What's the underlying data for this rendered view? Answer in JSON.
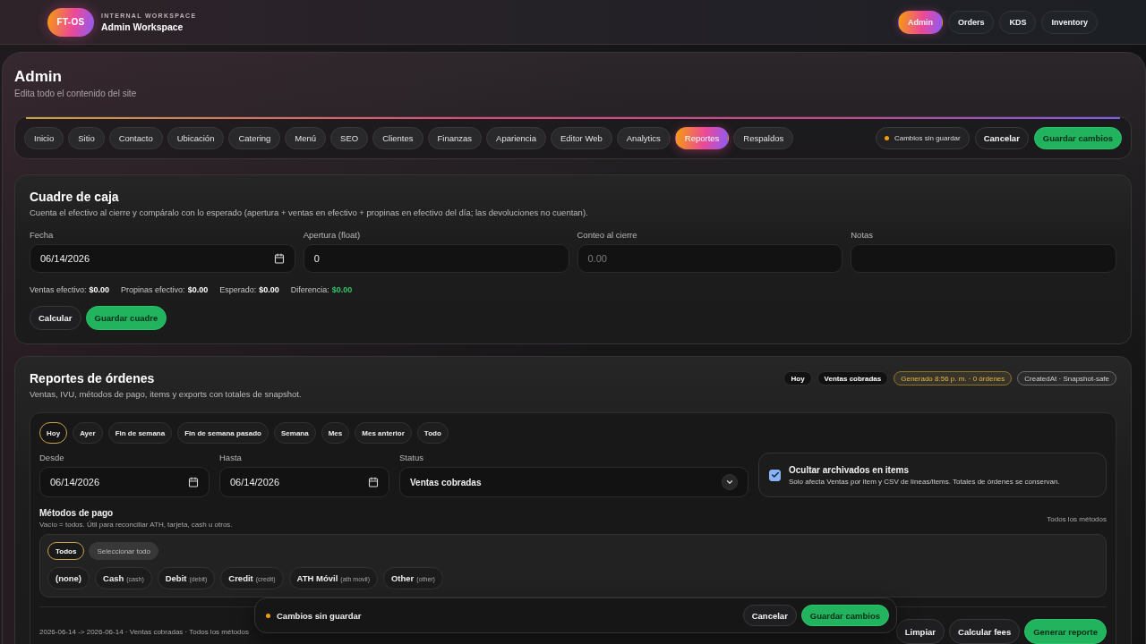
{
  "header": {
    "logo": "FT-OS",
    "eyebrow": "INTERNAL WORKSPACE",
    "title": "Admin Workspace",
    "nav": [
      {
        "label": "Admin",
        "selected": true
      },
      {
        "label": "Orders",
        "selected": false
      },
      {
        "label": "KDS",
        "selected": false
      },
      {
        "label": "Inventory",
        "selected": false
      }
    ]
  },
  "page": {
    "title": "Admin",
    "subtitle": "Edita todo el contenido del site"
  },
  "tabs": [
    {
      "label": "Inicio",
      "selected": false
    },
    {
      "label": "Sitio",
      "selected": false
    },
    {
      "label": "Contacto",
      "selected": false
    },
    {
      "label": "Ubicación",
      "selected": false
    },
    {
      "label": "Catering",
      "selected": false
    },
    {
      "label": "Menú",
      "selected": false
    },
    {
      "label": "SEO",
      "selected": false
    },
    {
      "label": "Clientes",
      "selected": false
    },
    {
      "label": "Finanzas",
      "selected": false
    },
    {
      "label": "Apariencia",
      "selected": false
    },
    {
      "label": "Editor Web",
      "selected": false
    },
    {
      "label": "Analytics",
      "selected": false
    },
    {
      "label": "Reportes",
      "selected": true
    },
    {
      "label": "Respaldos",
      "selected": false
    }
  ],
  "toolbar": {
    "status": "Cambios sin guardar",
    "buttons": [
      {
        "label": "Cancelar",
        "kind": "secondary"
      },
      {
        "label": "Guardar cambios",
        "kind": "primary"
      }
    ]
  },
  "cash_count": {
    "title": "Cuadre de caja",
    "description": "Cuenta el efectivo al cierre y compáralo con lo esperado (apertura + ventas en efectivo + propinas en efectivo del día; las devoluciones no cuentan).",
    "fields": [
      {
        "label": "Fecha",
        "kind": "date",
        "value": "06/14/2026"
      },
      {
        "label": "Apertura (float)",
        "kind": "number",
        "value": "0"
      },
      {
        "label": "Conteo al cierre",
        "kind": "number",
        "placeholder": "0.00"
      },
      {
        "label": "Notas",
        "kind": "text"
      }
    ],
    "summary": [
      {
        "label": "Ventas efectivo:",
        "value": "$0.00",
        "color": "#ffffff"
      },
      {
        "label": "Propinas efectivo:",
        "value": "$0.00",
        "color": "#ffffff"
      },
      {
        "label": "Esperado:",
        "value": "$0.00",
        "color": "#ffffff"
      },
      {
        "label": "Diferencia:",
        "value": "$0.00",
        "color": "#34c46a"
      }
    ],
    "buttons": [
      {
        "label": "Calcular",
        "kind": "secondary"
      },
      {
        "label": "Guardar cuadre",
        "kind": "primary"
      }
    ]
  },
  "reports": {
    "title": "Reportes de órdenes",
    "description": "Ventas, IVU, métodos de pago, items y exports con totales de snapshot.",
    "badges": [
      {
        "label": "Hoy",
        "kind": "filter"
      },
      {
        "label": "Ventas cobradas",
        "kind": "filter"
      },
      {
        "label": "Generado 8:56 p. m. · 0 órdenes",
        "kind": "status"
      },
      {
        "label": "CreatedAt · Snapshot-safe",
        "kind": "info"
      }
    ],
    "presets": [
      {
        "label": "Hoy",
        "selected": true
      },
      {
        "label": "Ayer",
        "selected": false
      },
      {
        "label": "Fin de semana",
        "selected": false
      },
      {
        "label": "Fin de semana pasado",
        "selected": false
      },
      {
        "label": "Semana",
        "selected": false
      },
      {
        "label": "Mes",
        "selected": false
      },
      {
        "label": "Mes anterior",
        "selected": false
      },
      {
        "label": "Todo",
        "selected": false
      }
    ],
    "filters": [
      {
        "label": "Desde",
        "kind": "date",
        "value": "06/14/2026"
      },
      {
        "label": "Hasta",
        "kind": "date",
        "value": "06/14/2026"
      },
      {
        "label": "Status",
        "kind": "select",
        "value": "Ventas cobradas"
      }
    ],
    "hide_archived": {
      "label": "Ocultar archivados en items",
      "description": "Solo afecta Ventas por item y CSV de líneas/items. Totales de órdenes se conservan.",
      "checked": true
    },
    "payment_methods": {
      "title": "Métodos de pago",
      "hint": "Vacío = todos. Útil para reconciliar ATH, tarjeta, cash u otros.",
      "summary": "Todos los métodos",
      "modes": [
        {
          "label": "Todos",
          "selected": true
        },
        {
          "label": "Seleccionar todo",
          "selected": false
        }
      ],
      "methods": [
        {
          "name": "(none)",
          "selected": false
        },
        {
          "name": "Cash",
          "code": "(cash)",
          "selected": false
        },
        {
          "name": "Debit",
          "code": "(debit)",
          "selected": false
        },
        {
          "name": "Credit",
          "code": "(credit)",
          "selected": false
        },
        {
          "name": "ATH Móvil",
          "code": "(ath movil)",
          "selected": false
        },
        {
          "name": "Other",
          "code": "(other)",
          "selected": false
        }
      ]
    },
    "footer": {
      "summary": "2026-06-14 -> 2026-06-14 · Ventas cobradas · Todos los métodos",
      "buttons": [
        {
          "label": "Limpiar",
          "kind": "secondary"
        },
        {
          "label": "Calcular fees",
          "kind": "secondary"
        },
        {
          "label": "Generar reporte",
          "kind": "primary"
        }
      ]
    }
  },
  "unsaved_bar": {
    "status": "Cambios sin guardar",
    "buttons": [
      {
        "label": "Cancelar",
        "kind": "secondary"
      },
      {
        "label": "Guardar cambios",
        "kind": "primary"
      }
    ]
  }
}
